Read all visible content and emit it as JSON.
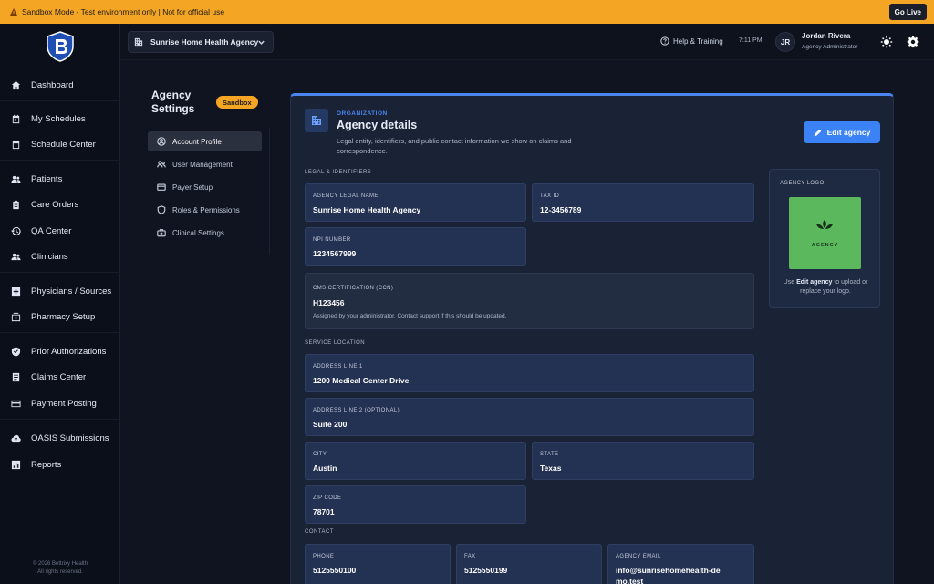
{
  "banner": {
    "text": "Sandbox Mode - Test environment only | Not for official use",
    "go_live": "Go Live"
  },
  "sidebar": {
    "items": [
      {
        "label": "Dashboard",
        "icon": "home-icon"
      },
      {
        "label": "My Schedules",
        "icon": "calendar-icon"
      },
      {
        "label": "Schedule Center",
        "icon": "calendar-icon"
      },
      {
        "label": "Patients",
        "icon": "people-icon"
      },
      {
        "label": "Care Orders",
        "icon": "clipboard-icon"
      },
      {
        "label": "QA Center",
        "icon": "history-icon"
      },
      {
        "label": "Clinicians",
        "icon": "people-icon"
      },
      {
        "label": "Physicians / Sources",
        "icon": "plus-box-icon"
      },
      {
        "label": "Pharmacy Setup",
        "icon": "pharmacy-icon"
      },
      {
        "label": "Prior Authorizations",
        "icon": "shield-check-icon"
      },
      {
        "label": "Claims Center",
        "icon": "document-icon"
      },
      {
        "label": "Payment Posting",
        "icon": "credit-card-icon"
      },
      {
        "label": "OASIS Submissions",
        "icon": "cloud-upload-icon"
      },
      {
        "label": "Reports",
        "icon": "chart-icon"
      }
    ],
    "footer_line1": "© 2026 Bettrixy Health",
    "footer_line2": "All rights reserved."
  },
  "header": {
    "agency": "Sunrise Home Health Agency",
    "help": "Help & Training",
    "time": "7:11 PM",
    "initials": "JR",
    "user_name": "Jordan Rivera",
    "user_role": "Agency Administrator"
  },
  "settings": {
    "title": "Agency Settings",
    "badge": "Sandbox",
    "nav": [
      {
        "label": "Account Profile",
        "active": true
      },
      {
        "label": "User Management",
        "active": false
      },
      {
        "label": "Payer Setup",
        "active": false
      },
      {
        "label": "Roles & Permissions",
        "active": false
      },
      {
        "label": "Clinical Settings",
        "active": false
      }
    ]
  },
  "panel": {
    "kicker": "ORGANIZATION",
    "title": "Agency details",
    "description": "Legal entity, identifiers, and public contact information we show on claims and correspondence.",
    "edit_button": "Edit agency",
    "sections": {
      "legal": "LEGAL & IDENTIFIERS",
      "location": "SERVICE LOCATION",
      "contact": "CONTACT"
    },
    "fields": {
      "legal_name": {
        "label": "AGENCY LEGAL NAME",
        "value": "Sunrise Home Health Agency"
      },
      "tax_id": {
        "label": "TAX ID",
        "value": "12-3456789"
      },
      "npi": {
        "label": "NPI NUMBER",
        "value": "1234567999"
      },
      "ccn": {
        "label": "CMS CERTIFICATION (CCN)",
        "value": "H123456",
        "note": "Assigned by your administrator. Contact support if this should be updated."
      },
      "address1": {
        "label": "ADDRESS LINE 1",
        "value": "1200 Medical Center Drive"
      },
      "address2": {
        "label": "ADDRESS LINE 2 (OPTIONAL)",
        "value": "Suite 200"
      },
      "city": {
        "label": "CITY",
        "value": "Austin"
      },
      "state": {
        "label": "STATE",
        "value": "Texas"
      },
      "zip": {
        "label": "ZIP CODE",
        "value": "78701"
      },
      "phone": {
        "label": "PHONE",
        "value": "5125550100"
      },
      "fax": {
        "label": "FAX",
        "value": "5125550199"
      },
      "email": {
        "label": "AGENCY EMAIL",
        "value": "info@sunrisehomehealth-demo.test"
      }
    },
    "logo": {
      "title": "AGENCY LOGO",
      "image_text": "AGENCY",
      "help_prefix": "Use",
      "help_link": "Edit agency",
      "help_suffix": "to upload or replace your logo."
    }
  },
  "colors": {
    "accent": "#3b82f6",
    "banner": "#f5a524",
    "logo_bg": "#5cb85c"
  }
}
